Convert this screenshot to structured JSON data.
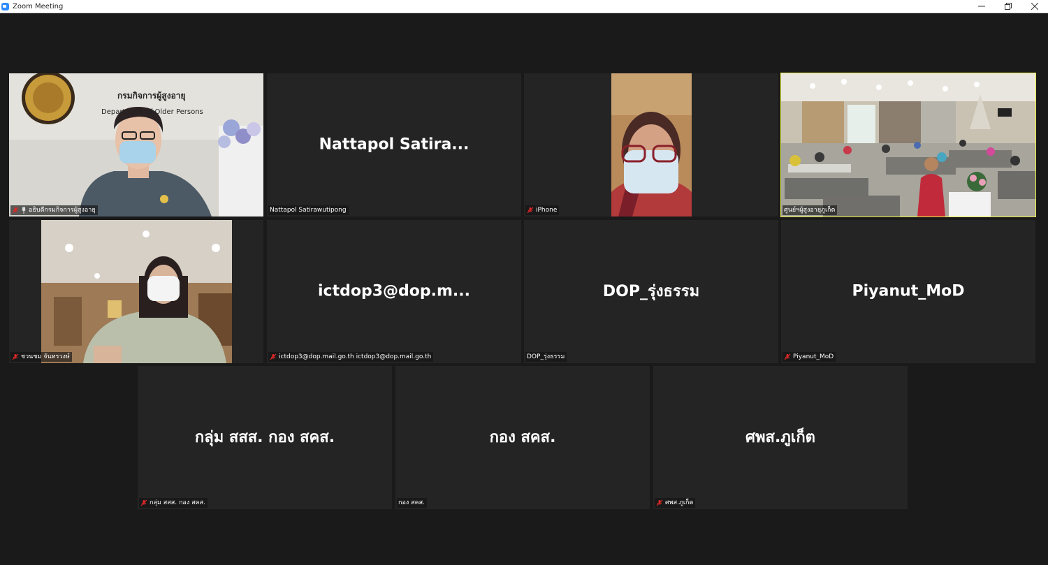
{
  "window": {
    "title": "Zoom Meeting",
    "minimize_glyph": "—",
    "maximize_glyph": "❐",
    "close_glyph": "✕"
  },
  "colors": {
    "background": "#1a1a1a",
    "tile_background": "#242424",
    "active_speaker_border": "#e8f044",
    "mute_icon": "#e02828"
  },
  "tiles": [
    {
      "label": "อธิบดีกรมกิจการผู้สูงอายุ",
      "muted": true,
      "pinned": true,
      "video": true,
      "sign_text_1": "กรมกิจการผู้สูงอายุ",
      "sign_text_2": "Department of Older Persons"
    },
    {
      "label": "Nattapol Satirawutipong",
      "display_name": "Nattapol  Satira...",
      "muted": false,
      "video": false
    },
    {
      "label": "iPhone",
      "muted": true,
      "video": true
    },
    {
      "label": "ศูนย์ฯผู้สูงอายุภูเก็ต",
      "muted": false,
      "video": true,
      "active_speaker": true
    },
    {
      "label": "ชวนชม จันทรวงษ์",
      "muted": true,
      "video": true
    },
    {
      "label": "ictdop3@dop.mail.go.th ictdop3@dop.mail.go.th",
      "display_name": "ictdop3@dop.m...",
      "muted": true,
      "video": false
    },
    {
      "label": "DOP_รุ่งธรรม",
      "display_name": "DOP_รุ่งธรรม",
      "muted": false,
      "video": false
    },
    {
      "label": "Piyanut_MoD",
      "display_name": "Piyanut_MoD",
      "muted": true,
      "video": false
    },
    {
      "label": "กลุ่ม สสส. กอง สคส.",
      "display_name": "กลุ่ม สสส. กอง สคส.",
      "muted": true,
      "video": false
    },
    {
      "label": "กอง สคส.",
      "display_name": "กอง สคส.",
      "muted": false,
      "video": false
    },
    {
      "label": "ศพส.ภูเก็ต",
      "display_name": "ศพส.ภูเก็ต",
      "muted": true,
      "video": false
    }
  ]
}
